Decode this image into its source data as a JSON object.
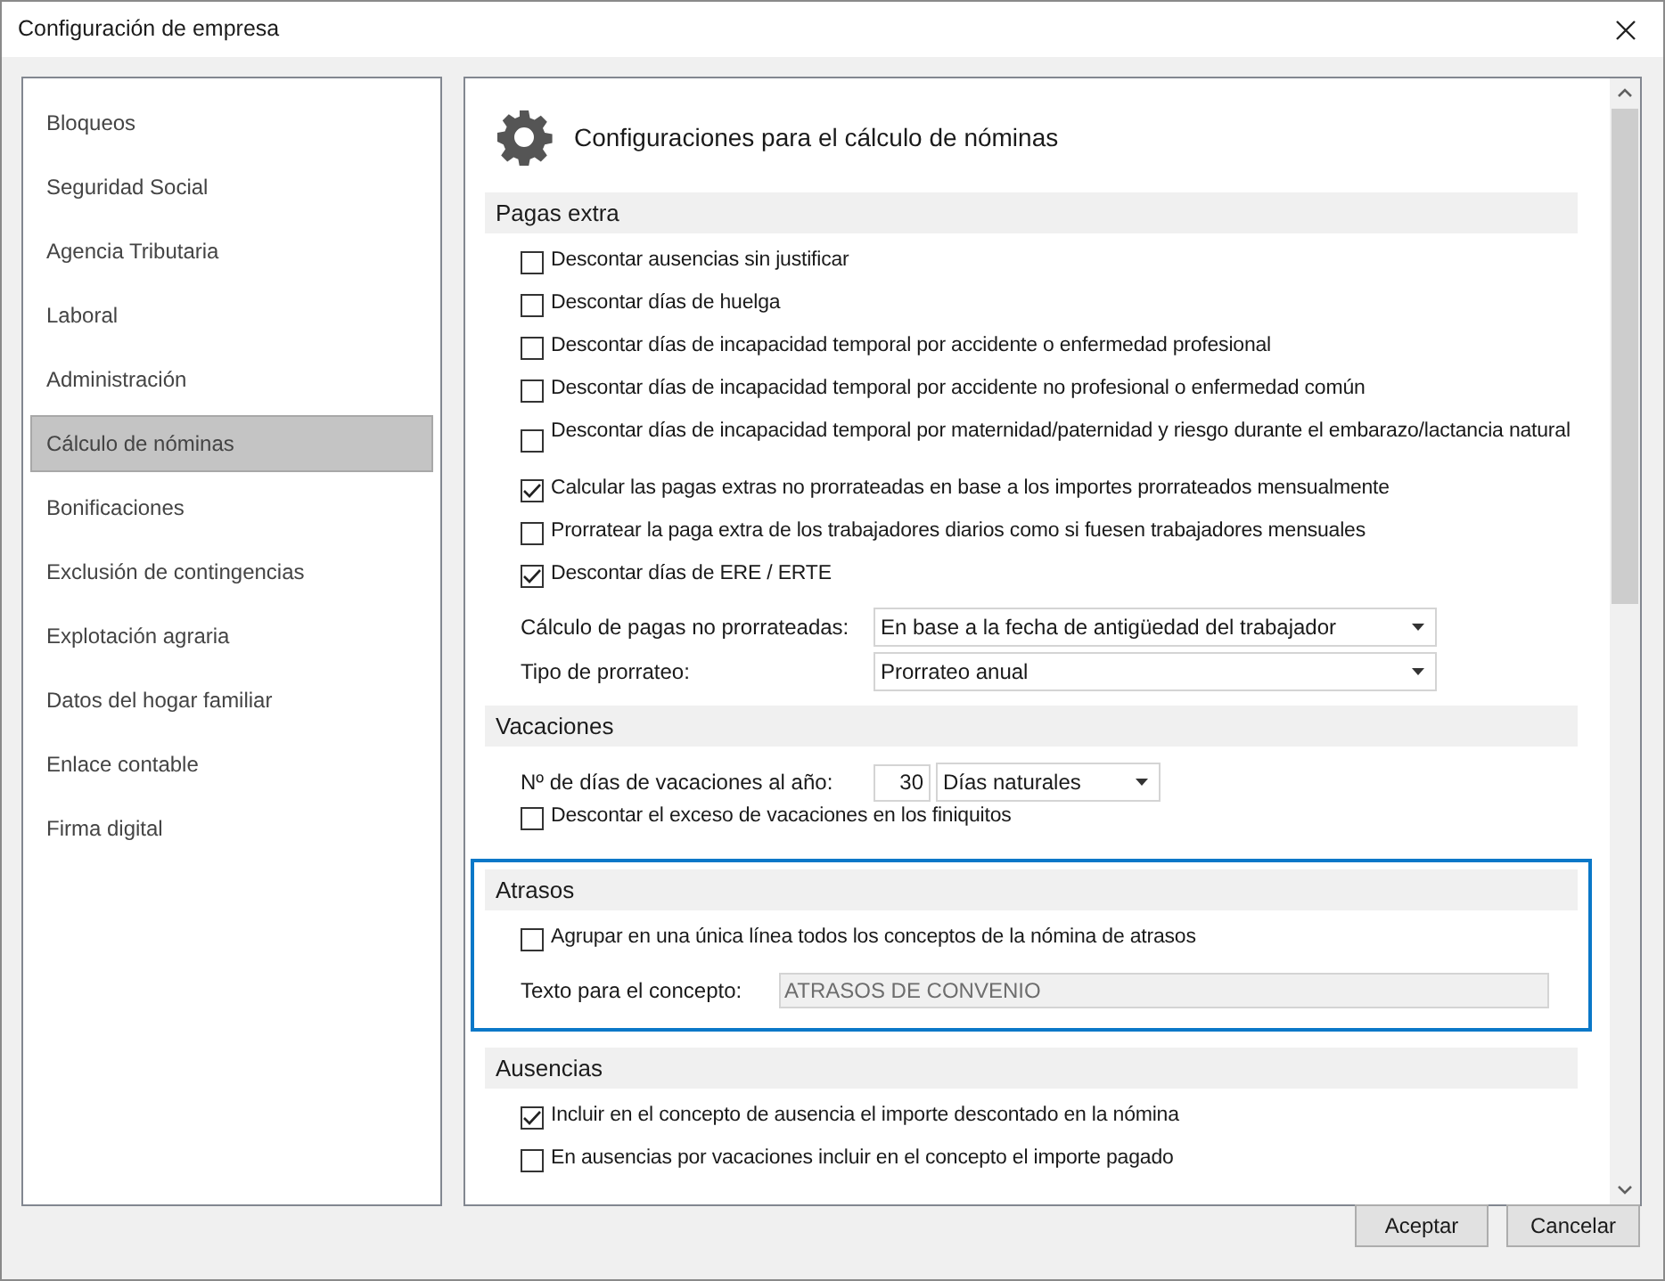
{
  "window": {
    "title": "Configuración de empresa"
  },
  "sidebar": {
    "items": [
      {
        "label": "Bloqueos",
        "selected": false
      },
      {
        "label": "Seguridad Social",
        "selected": false
      },
      {
        "label": "Agencia Tributaria",
        "selected": false
      },
      {
        "label": "Laboral",
        "selected": false
      },
      {
        "label": "Administración",
        "selected": false
      },
      {
        "label": "Cálculo de nóminas",
        "selected": true
      },
      {
        "label": "Bonificaciones",
        "selected": false
      },
      {
        "label": "Exclusión de contingencias",
        "selected": false
      },
      {
        "label": "Explotación agraria",
        "selected": false
      },
      {
        "label": "Datos del hogar familiar",
        "selected": false
      },
      {
        "label": "Enlace contable",
        "selected": false
      },
      {
        "label": "Firma digital",
        "selected": false
      }
    ]
  },
  "panel": {
    "title": "Configuraciones para el cálculo de nóminas",
    "sections": [
      {
        "title": "Pagas extra",
        "focused": false,
        "items": [
          {
            "kind": "checkbox",
            "label": "Descontar ausencias sin justificar",
            "checked": false
          },
          {
            "kind": "checkbox",
            "label": "Descontar días de huelga",
            "checked": false
          },
          {
            "kind": "checkbox",
            "label": "Descontar días de incapacidad temporal por accidente o enfermedad profesional",
            "checked": false
          },
          {
            "kind": "checkbox",
            "label": "Descontar días de incapacidad temporal por accidente no profesional o enfermedad común",
            "checked": false
          },
          {
            "kind": "checkbox",
            "label": "Descontar días de incapacidad temporal por maternidad/paternidad y riesgo durante el embarazo/lactancia natural",
            "checked": false
          },
          {
            "kind": "checkbox",
            "label": "Calcular las pagas extras no prorrateadas en base a los importes prorrateados mensualmente",
            "checked": true
          },
          {
            "kind": "checkbox",
            "label": "Prorratear la paga extra de los trabajadores diarios como si fuesen trabajadores mensuales",
            "checked": false
          },
          {
            "kind": "checkbox",
            "label": "Descontar días de ERE / ERTE",
            "checked": true
          },
          {
            "kind": "select",
            "label": "Cálculo de pagas no prorrateadas:",
            "value": "En base a la fecha de antigüedad del trabajador"
          },
          {
            "kind": "select",
            "label": "Tipo de prorrateo:",
            "value": "Prorrateo anual"
          }
        ]
      },
      {
        "title": "Vacaciones",
        "focused": false,
        "items": [
          {
            "kind": "number_select",
            "label": "Nº de días de vacaciones al año:",
            "number": "30",
            "value": "Días naturales"
          },
          {
            "kind": "checkbox",
            "label": "Descontar el exceso de vacaciones en los finiquitos",
            "checked": false
          }
        ]
      },
      {
        "title": "Atrasos",
        "focused": true,
        "items": [
          {
            "kind": "checkbox",
            "label": "Agrupar en una única línea todos los conceptos de la nómina de atrasos",
            "checked": false
          },
          {
            "kind": "text",
            "label": "Texto para el concepto:",
            "value": "ATRASOS DE CONVENIO",
            "disabled": true
          }
        ]
      },
      {
        "title": "Ausencias",
        "focused": false,
        "items": [
          {
            "kind": "checkbox",
            "label": "Incluir en el concepto de ausencia el importe descontado en la nómina",
            "checked": true
          },
          {
            "kind": "checkbox",
            "label": "En ausencias por vacaciones incluir en el concepto el importe pagado",
            "checked": false
          }
        ]
      }
    ]
  },
  "buttons": [
    "Aceptar",
    "Cancelar"
  ]
}
